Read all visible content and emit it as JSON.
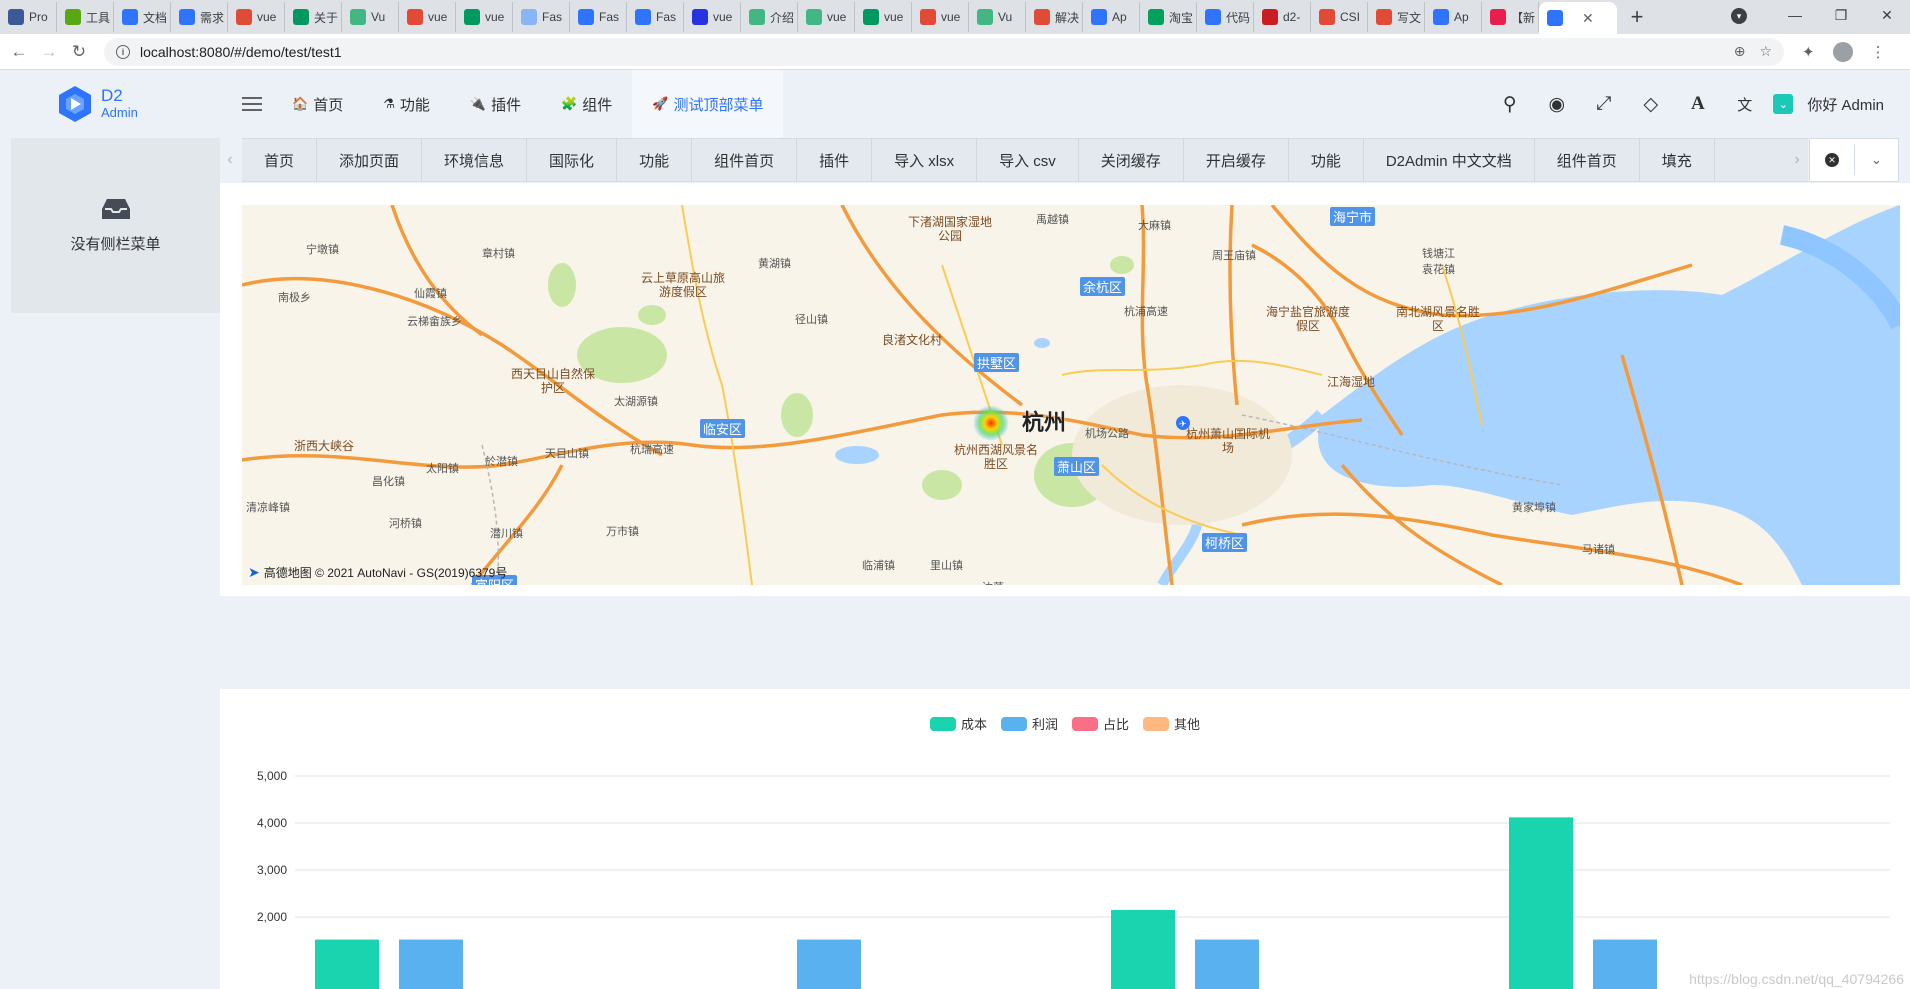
{
  "browser": {
    "tabs": [
      {
        "label": "Pro",
        "color": "#3b5998"
      },
      {
        "label": "工具",
        "color": "#58a814"
      },
      {
        "label": "文档",
        "color": "#2f74ff"
      },
      {
        "label": "需求",
        "color": "#2f74ff"
      },
      {
        "label": "vue",
        "color": "#e04b37"
      },
      {
        "label": "关于",
        "color": "#009a61"
      },
      {
        "label": "Vu",
        "color": "#41b883"
      },
      {
        "label": "vue",
        "color": "#e04b37"
      },
      {
        "label": "vue",
        "color": "#009a61"
      },
      {
        "label": "Fas",
        "color": "#8ab4f8"
      },
      {
        "label": "Fas",
        "color": "#2f74ff"
      },
      {
        "label": "Fas",
        "color": "#2f74ff"
      },
      {
        "label": "vue",
        "color": "#2932e1"
      },
      {
        "label": "介绍",
        "color": "#41b883"
      },
      {
        "label": "vue",
        "color": "#41b883"
      },
      {
        "label": "vue",
        "color": "#009a61"
      },
      {
        "label": "vue",
        "color": "#e04b37"
      },
      {
        "label": "Vu",
        "color": "#41b883"
      },
      {
        "label": "解决",
        "color": "#e04b37"
      },
      {
        "label": "Ap",
        "color": "#2f74ff"
      },
      {
        "label": "淘宝",
        "color": "#00a15c"
      },
      {
        "label": "代码",
        "color": "#2f74ff"
      },
      {
        "label": "d2-",
        "color": "#c71d23"
      },
      {
        "label": "CSI",
        "color": "#e04b37"
      },
      {
        "label": "写文",
        "color": "#e04b37"
      },
      {
        "label": "Ap",
        "color": "#2f74ff"
      },
      {
        "label": "【新",
        "color": "#e81e4d"
      }
    ],
    "active_tab_label": "",
    "url": "localhost:8080/#/demo/test/test1"
  },
  "header": {
    "logo_main": "D2",
    "logo_sub": "Admin",
    "menu": [
      {
        "label": "首页",
        "icon": "home-icon",
        "glyph": "🏠"
      },
      {
        "label": "功能",
        "icon": "flask-icon",
        "glyph": "⚗"
      },
      {
        "label": "插件",
        "icon": "plug-icon",
        "glyph": "🔌"
      },
      {
        "label": "组件",
        "icon": "puzzle-icon",
        "glyph": "🧩"
      },
      {
        "label": "测试顶部菜单",
        "icon": "rocket-icon",
        "glyph": "🚀"
      }
    ],
    "greeting": "你好 Admin"
  },
  "aside": {
    "empty_label": "没有侧栏菜单"
  },
  "page_tabs": [
    "首页",
    "添加页面",
    "环境信息",
    "国际化",
    "功能",
    "组件首页",
    "插件",
    "导入 xlsx",
    "导入 csv",
    "关闭缓存",
    "开启缓存",
    "功能",
    "D2Admin 中文文档",
    "组件首页",
    "填充"
  ],
  "map": {
    "attribution": "高德地图 © 2021 AutoNavi - GS(2019)6379号",
    "places": [
      {
        "name": "杭州",
        "big": true
      },
      {
        "name": "拱墅区",
        "district": true
      },
      {
        "name": "余杭区",
        "district": true
      },
      {
        "name": "临安区",
        "district": true
      },
      {
        "name": "萧山区",
        "district": true
      },
      {
        "name": "柯桥区",
        "district": true
      },
      {
        "name": "海宁市",
        "district": true
      },
      {
        "name": "富阳区",
        "district": true
      },
      {
        "name": "下渚湖国家湿地公园"
      },
      {
        "name": "云上草原高山旅游度假区"
      },
      {
        "name": "西天目山自然保护区"
      },
      {
        "name": "浙西大峡谷"
      },
      {
        "name": "杭州西湖风景名胜区"
      },
      {
        "name": "良渚文化村"
      },
      {
        "name": "海宁盐官旅游度假区"
      },
      {
        "name": "南北湖风景名胜区"
      },
      {
        "name": "江海湿地"
      },
      {
        "name": "杭州萧山国际机场"
      },
      {
        "name": "宁墩镇"
      },
      {
        "name": "南极乡"
      },
      {
        "name": "章村镇"
      },
      {
        "name": "仙霞镇"
      },
      {
        "name": "云梯畲族乡"
      },
      {
        "name": "太湖源镇"
      },
      {
        "name": "黄湖镇"
      },
      {
        "name": "径山镇"
      },
      {
        "name": "於潜镇"
      },
      {
        "name": "天目山镇"
      },
      {
        "name": "昌化镇"
      },
      {
        "name": "太阳镇"
      },
      {
        "name": "河桥镇"
      },
      {
        "name": "清凉峰镇"
      },
      {
        "name": "潜川镇"
      },
      {
        "name": "万市镇"
      },
      {
        "name": "禹越镇"
      },
      {
        "name": "大麻镇"
      },
      {
        "name": "周王庙镇"
      },
      {
        "name": "袁花镇"
      },
      {
        "name": "黄家埠镇"
      },
      {
        "name": "马诸镇"
      },
      {
        "name": "里山镇"
      },
      {
        "name": "临浦镇"
      },
      {
        "name": "沈荡"
      },
      {
        "name": "机场公路"
      },
      {
        "name": "杭瑞高速"
      },
      {
        "name": "杭浦高速"
      },
      {
        "name": "钱塘江"
      }
    ]
  },
  "chart_data": {
    "type": "bar",
    "legend": [
      "成本",
      "利润",
      "占比",
      "其他"
    ],
    "colors": [
      "#19d4ae",
      "#5ab1ef",
      "#fa6e86",
      "#ffb980"
    ],
    "ylim": [
      0,
      5000
    ],
    "yticks": [
      "5,000",
      "4,000",
      "3,000",
      "2,000"
    ],
    "categories": [
      "",
      "",
      "",
      ""
    ],
    "series": [
      {
        "name": "成本",
        "values": [
          1520,
          null,
          2150,
          4120
        ]
      },
      {
        "name": "利润",
        "values": [
          1520,
          1520,
          1520,
          1520
        ]
      }
    ]
  },
  "watermark": "https://blog.csdn.net/qq_40794266"
}
